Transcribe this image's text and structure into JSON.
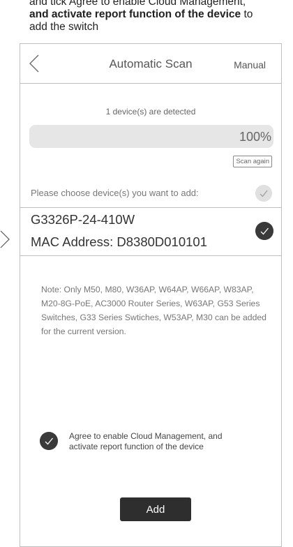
{
  "instruction": {
    "line1": "and tick Agree to enable Cloud Management,",
    "line2_bold": "and activate report function of the device",
    "line2_tail": " to",
    "line3": "add the switch"
  },
  "nav": {
    "title": "Automatic Scan",
    "manual": "Manual"
  },
  "scan": {
    "detected_text": "1 device(s) are detected",
    "progress_text": "100%",
    "progress_value": 100,
    "scan_again": "Scan again"
  },
  "choose_label": "Please choose device(s) you want to add:",
  "device": {
    "model": "G3326P-24-410W",
    "mac": "MAC Address: D8380D010101",
    "selected": true
  },
  "note": "Note: Only M50, M80, W36AP, W64AP, W66AP, W83AP, M20-8G-PoE, AC3000 Router Series, W63AP, G53 Series Switches, G33 Series Swtiches, W53AP, M30 can be added for the current version.",
  "agree": {
    "text": "Agree to enable Cloud Management, and activate report function of the device",
    "checked": true
  },
  "add_button": "Add",
  "colors": {
    "dark": "#2e2e2e",
    "border": "#bfbfbf",
    "progress_bg": "#e6e6e6"
  }
}
